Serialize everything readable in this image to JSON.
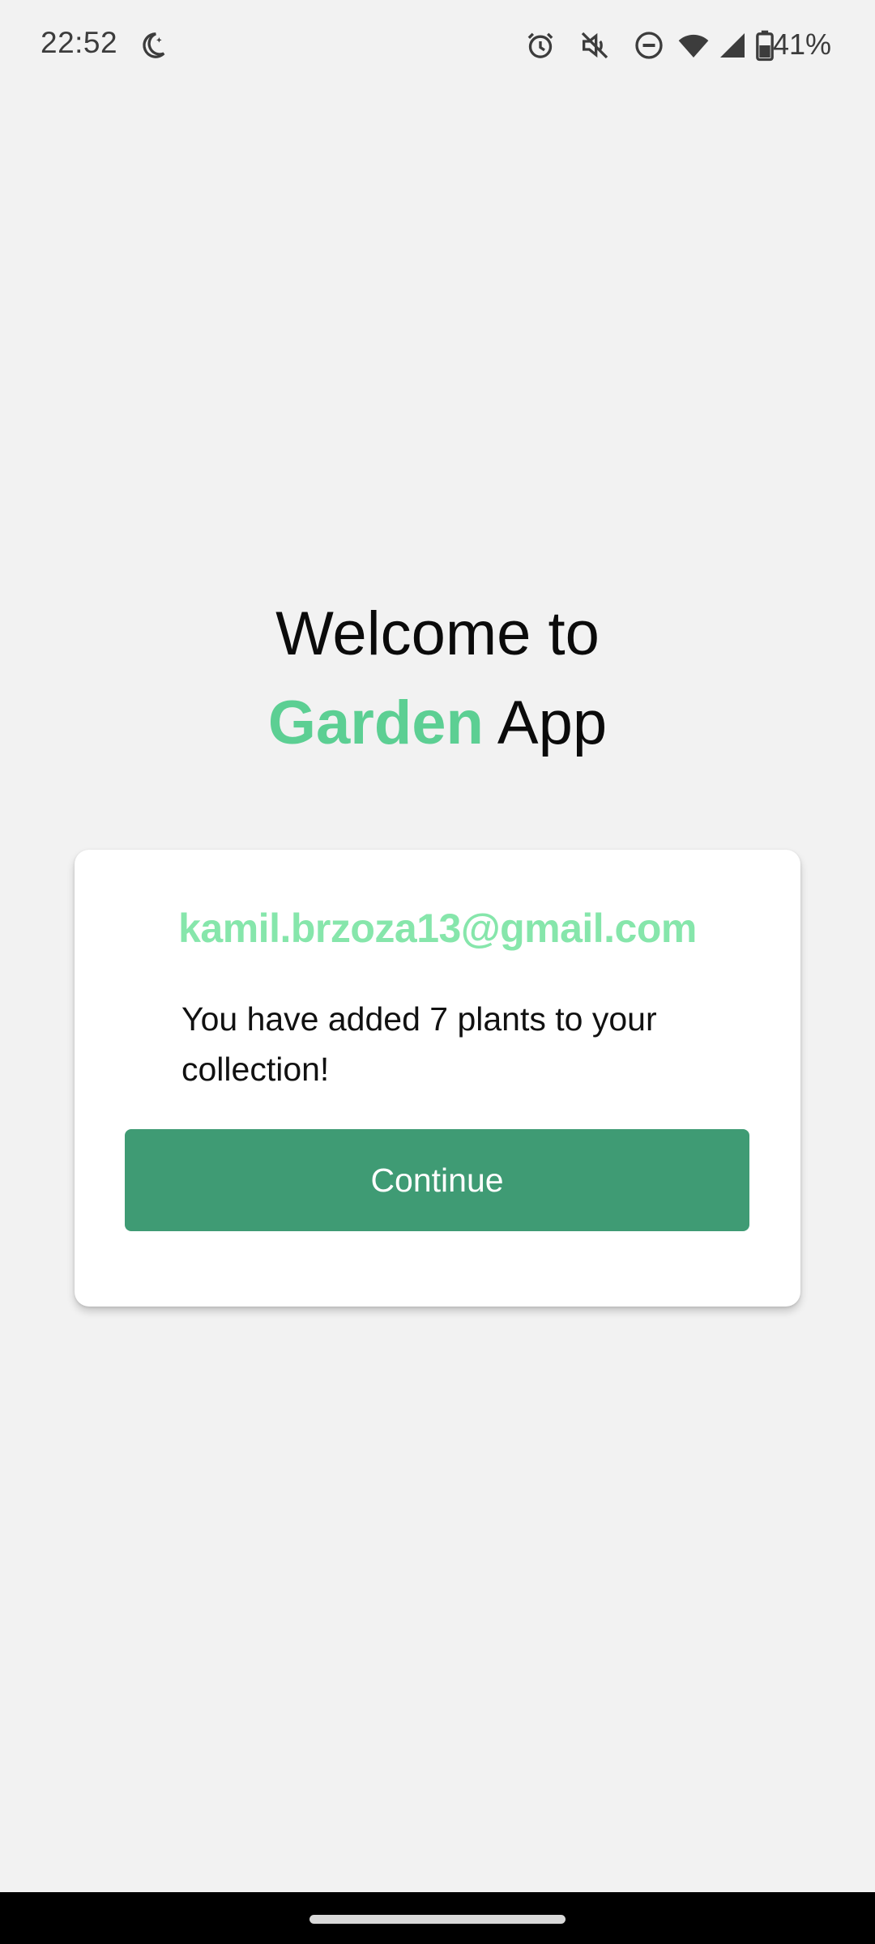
{
  "status_bar": {
    "time": "22:52",
    "battery_percent": "41%",
    "icons": [
      "moon-icon",
      "alarm-icon",
      "mute-icon",
      "do-not-disturb-icon",
      "wifi-icon",
      "signal-icon",
      "battery-icon"
    ]
  },
  "welcome": {
    "line1": "Welcome to",
    "brand": "Garden",
    "app": "App"
  },
  "card": {
    "email": "kamil.brzoza13@gmail.com",
    "message": "You have added 7 plants to your collection!",
    "continue_label": "Continue"
  },
  "colors": {
    "background": "#f2f2f2",
    "brand_green": "#5ccf93",
    "email_green": "#86e6ab",
    "button_green": "#3f9b74",
    "card": "#ffffff"
  }
}
